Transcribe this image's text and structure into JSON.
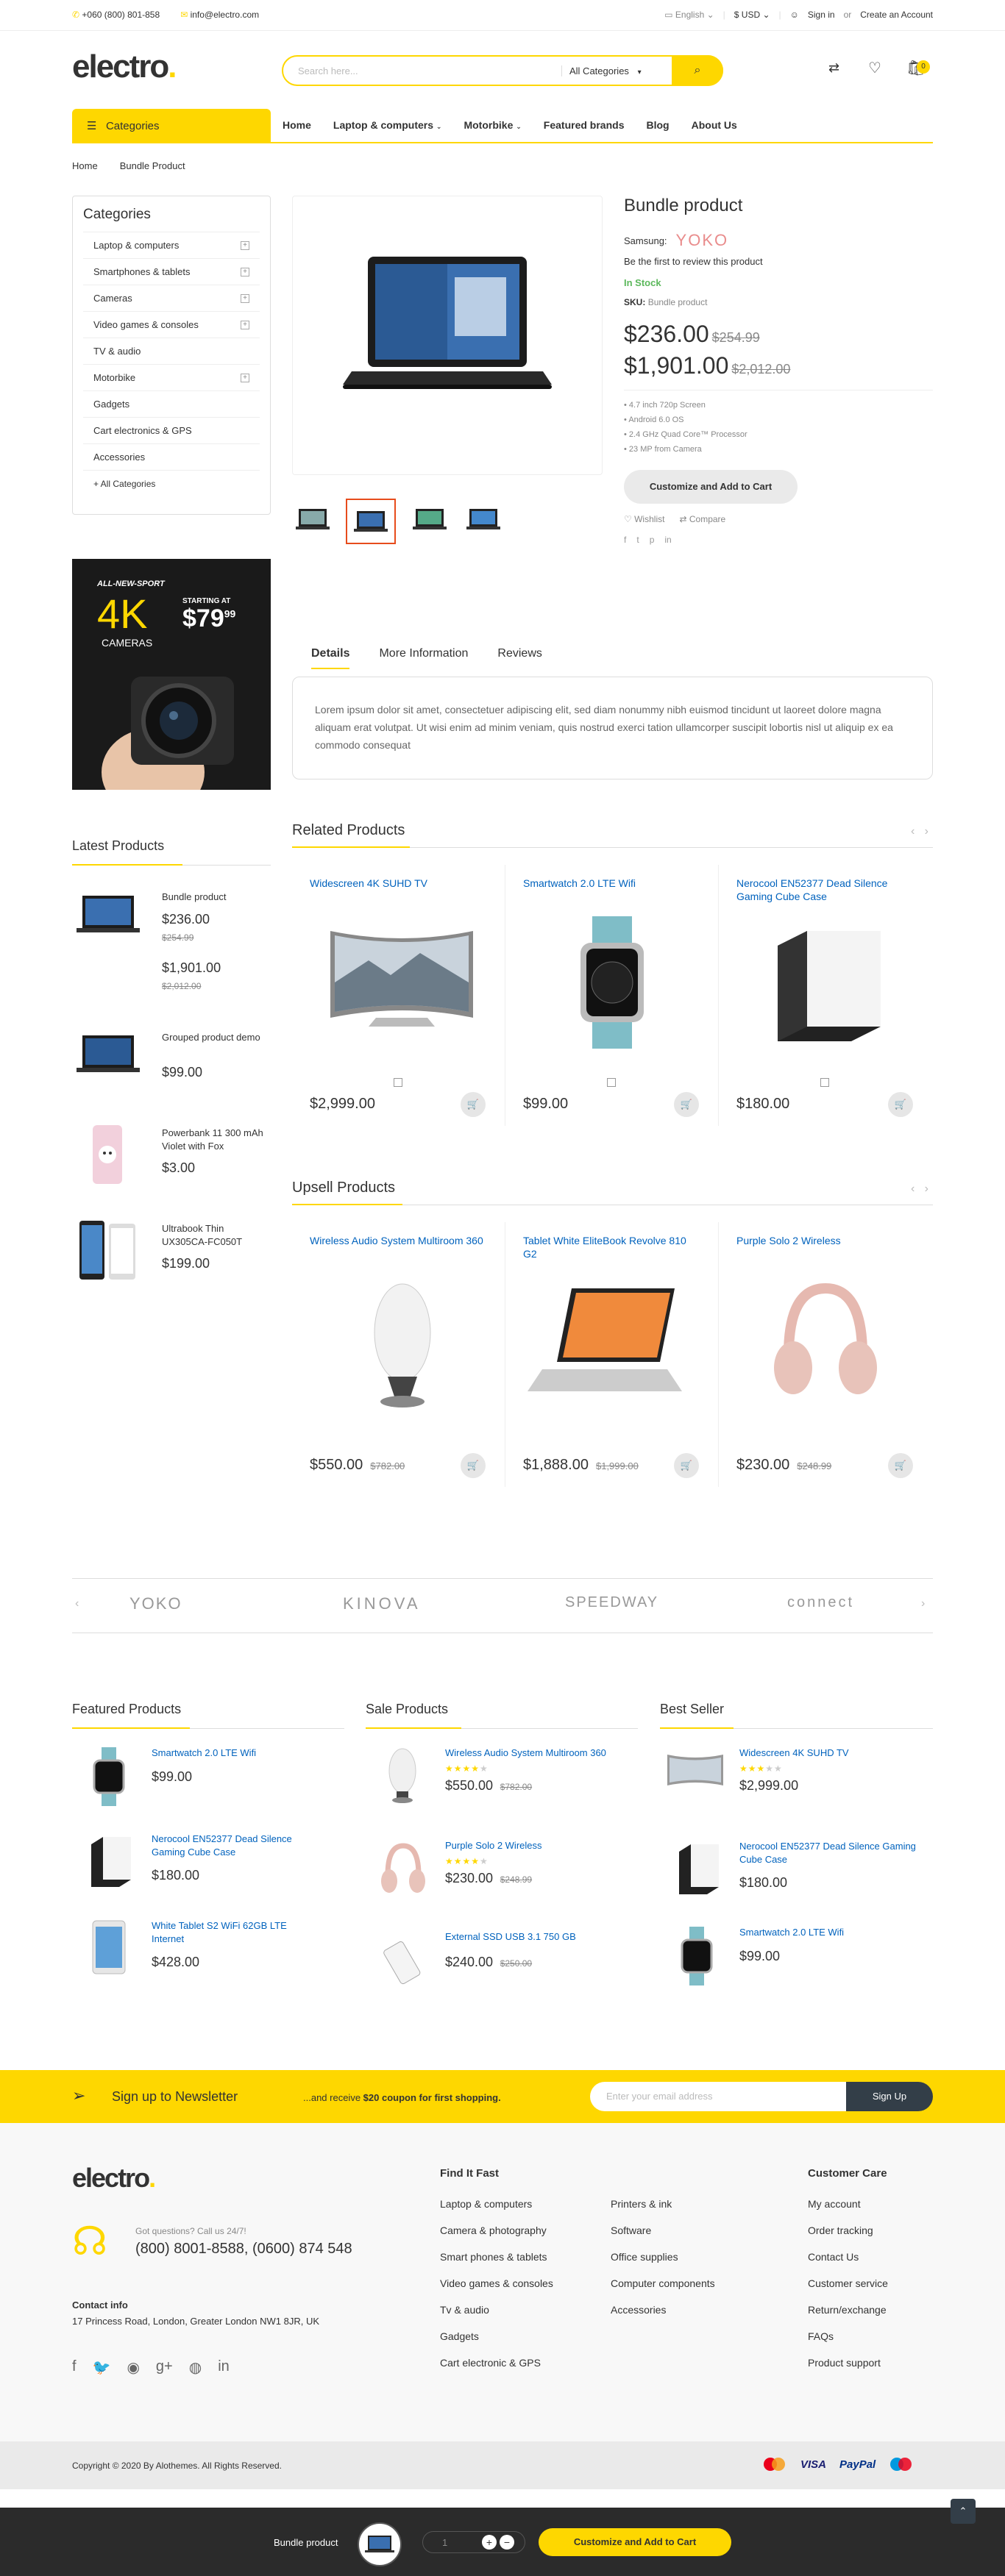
{
  "topbar": {
    "phone": "+060 (800) 801-858",
    "email": "info@electro.com",
    "language": "English",
    "currency": "$ USD",
    "signin": "Sign in",
    "or": "or",
    "create": "Create an Account"
  },
  "header": {
    "logo": "electro",
    "search_placeholder": "Search here...",
    "search_category": "All Categories",
    "cart_count": "0"
  },
  "nav": {
    "categories_label": "Categories",
    "items": [
      "Home",
      "Laptop & computers",
      "Motorbike",
      "Featured brands",
      "Blog",
      "About Us"
    ]
  },
  "breadcrumb": [
    "Home",
    "Bundle Product"
  ],
  "sidebar": {
    "title": "Categories",
    "items": [
      "Laptop & computers",
      "Smartphones & tablets",
      "Cameras",
      "Video games & consoles",
      "TV & audio",
      "Motorbike",
      "Gadgets",
      "Cart electronics & GPS",
      "Accessories"
    ],
    "all": "+ All Categories"
  },
  "banner": {
    "line1": "ALL-NEW-SPORT",
    "big": "4K",
    "line2": "CAMERAS",
    "starting": "STARTING AT",
    "price": "$79",
    "cents": "99"
  },
  "product": {
    "title": "Bundle product",
    "brand_label": "Samsung:",
    "brand_logo": "YOKO",
    "review": "Be the first to review this product",
    "stock": "In Stock",
    "sku_label": "SKU:",
    "sku": "Bundle product",
    "price1": "$236.00",
    "old1": "$254.99",
    "price2": "$1,901.00",
    "old2": "$2,012.00",
    "features": [
      "4.7 inch 720p Screen",
      "Android 6.0 OS",
      "2.4 GHz Quad Core™ Processor",
      "23 MP from Camera"
    ],
    "add_btn": "Customize and Add to Cart",
    "wishlist": "Wishlist",
    "compare": "Compare"
  },
  "tabs": {
    "items": [
      "Details",
      "More Information",
      "Reviews"
    ],
    "body": "Lorem ipsum dolor sit amet, consectetuer adipiscing elit, sed diam nonummy nibh euismod tincidunt ut laoreet dolore magna aliquam erat volutpat. Ut wisi enim ad minim veniam, quis nostrud exerci tation ullamcorper suscipit lobortis nisl ut aliquip ex ea commodo consequat"
  },
  "latest": {
    "title": "Latest Products",
    "items": [
      {
        "name": "Bundle product",
        "p1": "$236.00",
        "o1": "$254.99",
        "p2": "$1,901.00",
        "o2": "$2,012.00"
      },
      {
        "name": "Grouped product demo",
        "p1": "$99.00"
      },
      {
        "name": "Powerbank 11 300 mAh Violet with Fox",
        "p1": "$3.00"
      },
      {
        "name": "Ultrabook Thin UX305CA-FC050T",
        "p1": "$199.00"
      }
    ]
  },
  "related": {
    "title": "Related Products",
    "items": [
      {
        "name": "Widescreen 4K SUHD TV",
        "price": "$2,999.00"
      },
      {
        "name": "Smartwatch 2.0 LTE Wifi",
        "price": "$99.00"
      },
      {
        "name": "Nerocool EN52377 Dead Silence Gaming Cube Case",
        "price": "$180.00"
      }
    ]
  },
  "upsell": {
    "title": "Upsell Products",
    "items": [
      {
        "name": "Wireless Audio System Multiroom 360",
        "price": "$550.00",
        "old": "$782.00"
      },
      {
        "name": "Tablet White EliteBook Revolve 810 G2",
        "price": "$1,888.00",
        "old": "$1,999.00"
      },
      {
        "name": "Purple Solo 2 Wireless",
        "price": "$230.00",
        "old": "$248.99"
      }
    ]
  },
  "brands": [
    "YOKO",
    "KINOVA",
    "SPEEDWAY",
    "connect"
  ],
  "featured": {
    "title": "Featured Products",
    "items": [
      {
        "name": "Smartwatch 2.0 LTE Wifi",
        "price": "$99.00"
      },
      {
        "name": "Nerocool EN52377 Dead Silence Gaming Cube Case",
        "price": "$180.00"
      },
      {
        "name": "White Tablet S2 WiFi 62GB LTE Internet",
        "price": "$428.00"
      }
    ]
  },
  "sale": {
    "title": "Sale Products",
    "items": [
      {
        "name": "Wireless Audio System Multiroom 360",
        "price": "$550.00",
        "old": "$782.00"
      },
      {
        "name": "Purple Solo 2 Wireless",
        "price": "$230.00",
        "old": "$248.99"
      },
      {
        "name": "External SSD USB 3.1 750 GB",
        "price": "$240.00",
        "old": "$250.00"
      }
    ]
  },
  "best": {
    "title": "Best Seller",
    "items": [
      {
        "name": "Widescreen 4K SUHD TV",
        "price": "$2,999.00"
      },
      {
        "name": "Nerocool EN52377 Dead Silence Gaming Cube Case",
        "price": "$180.00"
      },
      {
        "name": "Smartwatch 2.0 LTE Wifi",
        "price": "$99.00"
      }
    ]
  },
  "newsletter": {
    "title": "Sign up to Newsletter",
    "text_pre": "...and receive",
    "text_bold": "$20 coupon for first shopping.",
    "placeholder": "Enter your email address",
    "btn": "Sign Up"
  },
  "footer": {
    "logo": "electro",
    "question": "Got questions? Call us 24/7!",
    "phones": "(800) 8001-8588, (0600) 874 548",
    "contact_title": "Contact info",
    "address": "17 Princess Road, London, Greater London NW1 8JR, UK",
    "find_title": "Find It Fast",
    "col1": [
      "Laptop & computers",
      "Camera & photography",
      "Smart phones & tablets",
      "Video games & consoles",
      "Tv & audio",
      "Gadgets",
      "Cart electronic & GPS"
    ],
    "col2": [
      "Printers & ink",
      "Software",
      "Office supplies",
      "Computer components",
      "Accessories"
    ],
    "care_title": "Customer Care",
    "col3": [
      "My account",
      "Order tracking",
      "Contact Us",
      "Customer service",
      "Return/exchange",
      "FAQs",
      "Product support"
    ],
    "copyright": "Copyright © 2020 By Alothemes. All Rights Reserved.",
    "payments": [
      "VISA",
      "PayPal"
    ]
  },
  "stickybar": {
    "name": "Bundle product",
    "qty": "1",
    "btn": "Customize and Add to Cart"
  },
  "colors": {
    "accent": "#fed700",
    "link": "#0062bd",
    "stock": "#5cb85c"
  }
}
